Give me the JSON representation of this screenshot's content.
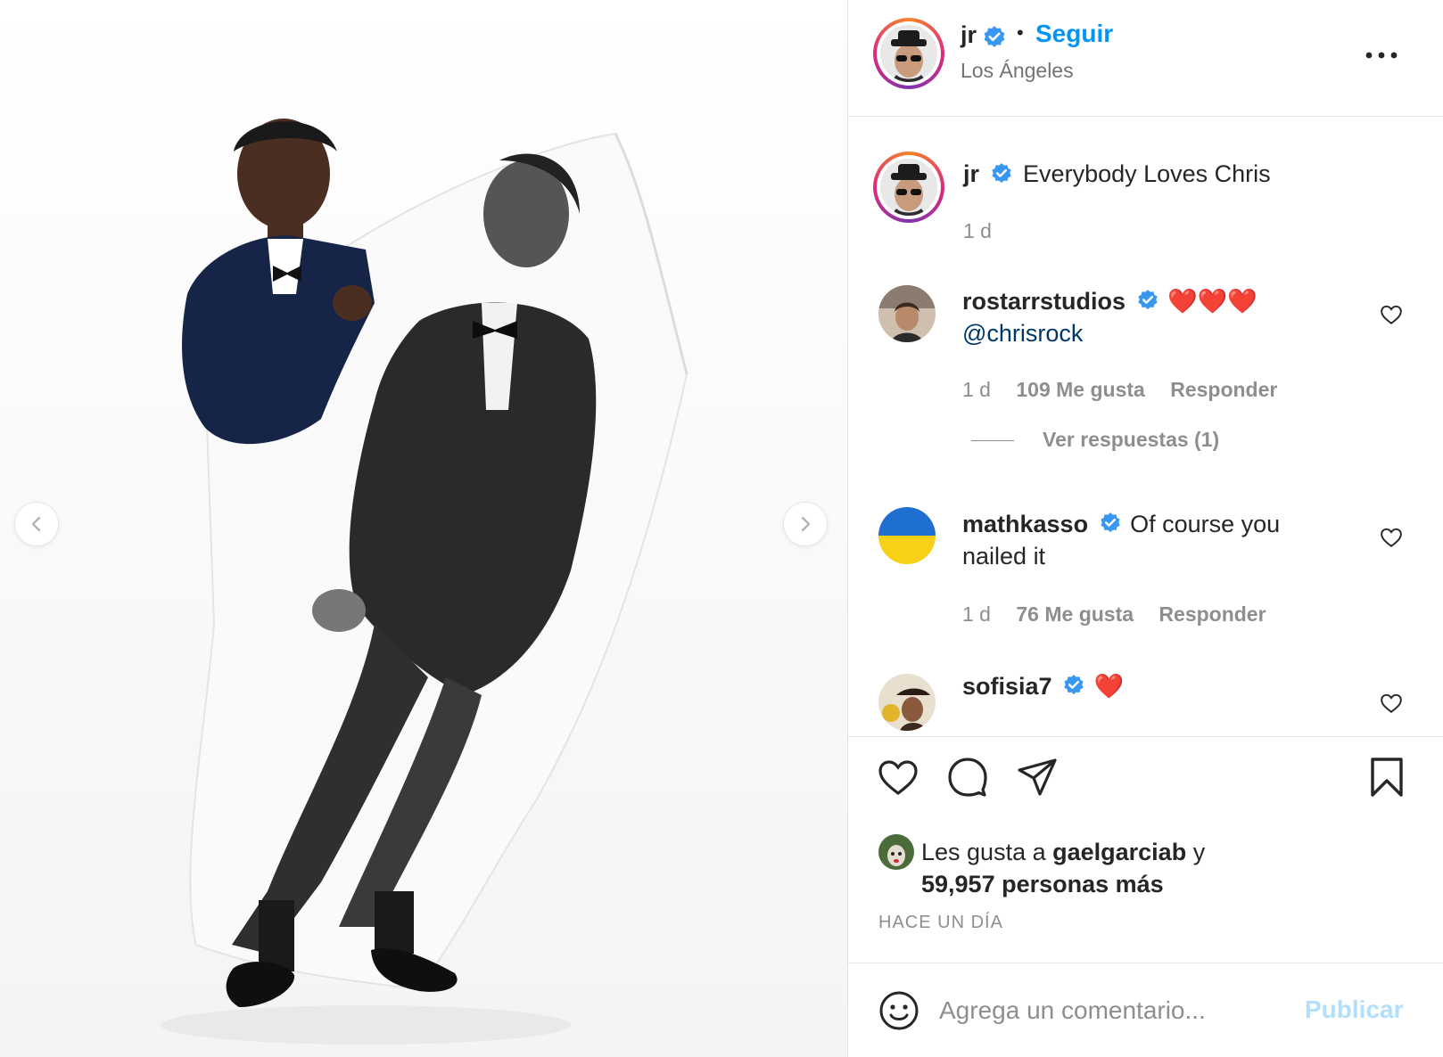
{
  "colors": {
    "accent": "#0095f6",
    "text": "#262626",
    "muted": "#8e8e8e",
    "mention": "#00376b",
    "publish_disabled": "#b2dffc",
    "verified": "#3897f0",
    "heart_red": "#ed1c24"
  },
  "media": {
    "prev_icon": "chevron-left-icon",
    "next_icon": "chevron-right-icon"
  },
  "header": {
    "username": "jr",
    "separator": "•",
    "follow_label": "Seguir",
    "location": "Los Ángeles",
    "more_icon": "more-horizontal-icon"
  },
  "caption": {
    "username": "jr",
    "text": "Everybody Loves Chris",
    "time": "1 d"
  },
  "comments": [
    {
      "username": "rostarrstudios",
      "text": "❤️❤️❤️",
      "mention": "@chrisrock",
      "time": "1 d",
      "likes": "109 Me gusta",
      "reply_label": "Responder"
    },
    {
      "username": "mathkasso",
      "text": "Of course you nailed it",
      "time": "1 d",
      "likes": "76 Me gusta",
      "reply_label": "Responder"
    },
    {
      "username": "sofisia7",
      "text": "❤️"
    }
  ],
  "view_replies": "Ver respuestas (1)",
  "actions": {
    "like_icon": "heart-icon",
    "comment_icon": "comment-icon",
    "share_icon": "send-icon",
    "save_icon": "bookmark-icon"
  },
  "likes": {
    "prefix": "Les gusta a",
    "user": "gaelgarciab",
    "joiner": "y",
    "others": "59,957 personas más"
  },
  "timestamp": "HACE UN DÍA",
  "composer": {
    "placeholder": "Agrega un comentario...",
    "publish_label": "Publicar",
    "emoji_icon": "smiley-icon"
  }
}
